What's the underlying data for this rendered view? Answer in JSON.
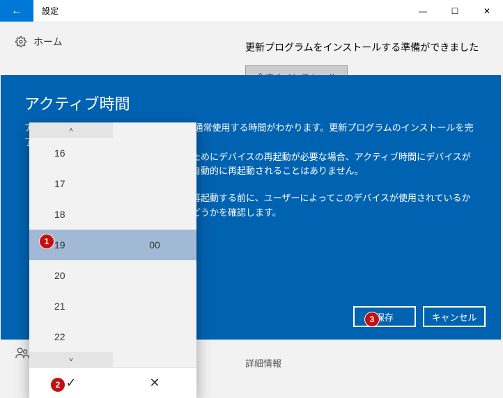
{
  "window": {
    "title": "設定",
    "back_icon": "←",
    "min_icon": "—",
    "max_icon": "☐",
    "close_icon": "✕"
  },
  "background": {
    "home_label": "ホーム",
    "update_message": "更新プログラムをインストールする準備ができました",
    "install_btn": "今すぐインストール",
    "detail_info": "詳細情報"
  },
  "overlay": {
    "title": "アクティブ時間",
    "line1_a": "アクティブ時間によって、このデバイスを通常使用する時間がわかります。更新プログラムのインストールを完了する",
    "line1_b": "ためにデバイスの再起動が必要な場合、アクティブ時間にデバイスが自動的に再起動されることはありません。",
    "line2": "再起動する前に、ユーザーによってこのデバイスが使用されているかどうかを確認します。",
    "save": "保存",
    "cancel": "キャンセル"
  },
  "picker": {
    "up": "˄",
    "down": "˅",
    "hours": [
      "16",
      "17",
      "18",
      "19",
      "20",
      "21",
      "22"
    ],
    "selected_hour": "19",
    "selected_minute": "00",
    "confirm": "✓",
    "cancel": "✕"
  },
  "badges": {
    "b1": "1",
    "b2": "2",
    "b3": "3"
  }
}
